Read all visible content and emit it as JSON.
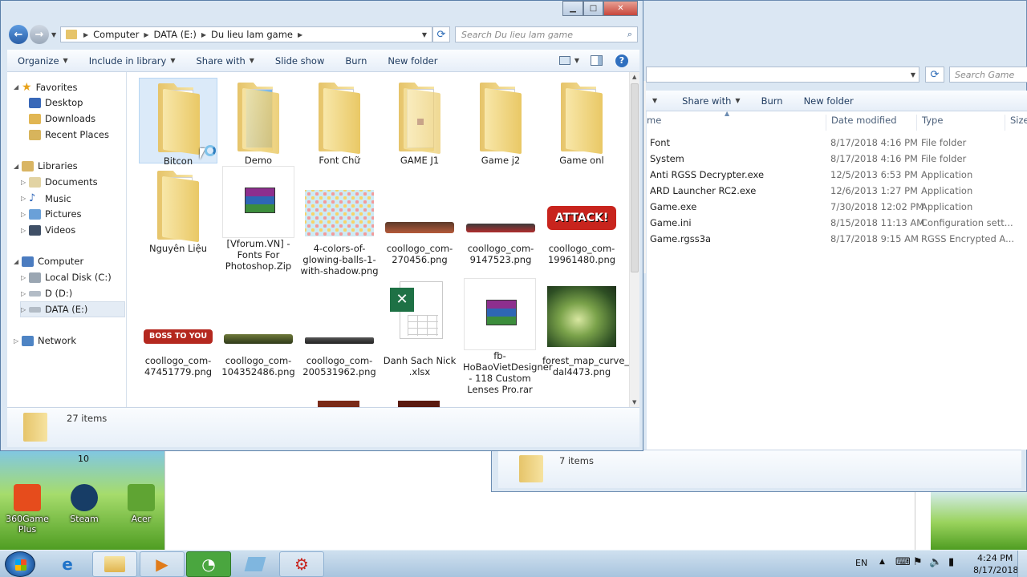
{
  "desktop": {
    "icons": [
      {
        "label": "360Game Plus",
        "color": "#e64c1c"
      },
      {
        "label": "Steam",
        "color": "#173d66"
      },
      {
        "label": "Acer",
        "color": "#5fa433"
      }
    ],
    "badge": "10"
  },
  "front": {
    "breadcrumb": [
      "Computer",
      "DATA (E:)",
      "Du lieu lam game"
    ],
    "search_placeholder": "Search Du lieu lam game",
    "toolbar": [
      "Organize",
      "Include in library",
      "Share with",
      "Slide show",
      "Burn",
      "New folder"
    ],
    "nav": {
      "favorites": "Favorites",
      "fav_items": [
        "Desktop",
        "Downloads",
        "Recent Places"
      ],
      "libraries": "Libraries",
      "lib_items": [
        "Documents",
        "Music",
        "Pictures",
        "Videos"
      ],
      "computer": "Computer",
      "comp_items": [
        "Local Disk (C:)",
        "D (D:)",
        "DATA (E:)"
      ],
      "network": "Network"
    },
    "files": [
      {
        "label": "Bitcon",
        "kind": "folder"
      },
      {
        "label": "Demo",
        "kind": "folder-blue"
      },
      {
        "label": "Font Chữ",
        "kind": "folder"
      },
      {
        "label": "GAME J1",
        "kind": "folder-game"
      },
      {
        "label": "Game j2",
        "kind": "folder"
      },
      {
        "label": "Game onl",
        "kind": "folder"
      },
      {
        "label": "Nguyên Liệu",
        "kind": "folder"
      },
      {
        "label": "[Vforum.VN] - Fonts For Photoshop.Zip",
        "kind": "rar"
      },
      {
        "label": "4-colors-of-glowing-balls-1-with-shadow.png",
        "kind": "balls"
      },
      {
        "label": "coollogo_com-270456.png",
        "kind": "logo"
      },
      {
        "label": "coollogo_com-9147523.png",
        "kind": "logo"
      },
      {
        "label": "coollogo_com-19961480.png",
        "kind": "logo-big",
        "text": "ATTACK!"
      },
      {
        "label": "coollogo_com-47451779.png",
        "kind": "logo-mid",
        "text": "BOSS TO YOU"
      },
      {
        "label": "coollogo_com-104352486.png",
        "kind": "logo"
      },
      {
        "label": "coollogo_com-200531962.png",
        "kind": "logo"
      },
      {
        "label": "Danh Sach Nick .xlsx",
        "kind": "xlsx"
      },
      {
        "label": "fb-HoBaoVietDesigner - 118 Custom Lenses Pro.rar",
        "kind": "rar"
      },
      {
        "label": "forest_map_curve_by_davidbrowne-dal4473.png",
        "kind": "forest"
      }
    ],
    "status": "27 items"
  },
  "back": {
    "search_placeholder": "Search Game",
    "toolbar": [
      "Share with",
      "Burn",
      "New folder"
    ],
    "columns": {
      "name": "me",
      "date": "Date modified",
      "type": "Type",
      "size": "Size"
    },
    "rows": [
      {
        "name": "Font",
        "date": "8/17/2018 4:16 PM",
        "type": "File folder"
      },
      {
        "name": "System",
        "date": "8/17/2018 4:16 PM",
        "type": "File folder"
      },
      {
        "name": "Anti RGSS Decrypter.exe",
        "date": "12/5/2013 6:53 PM",
        "type": "Application"
      },
      {
        "name": "ARD Launcher RC2.exe",
        "date": "12/6/2013 1:27 PM",
        "type": "Application"
      },
      {
        "name": "Game.exe",
        "date": "7/30/2018 12:02 PM",
        "type": "Application"
      },
      {
        "name": "Game.ini",
        "date": "8/15/2018 11:13 AM",
        "type": "Configuration sett..."
      },
      {
        "name": "Game.rgss3a",
        "date": "8/17/2018 9:15 AM",
        "type": "RGSS Encrypted A..."
      }
    ],
    "status": "7 items"
  },
  "taskbar": {
    "lang": "EN",
    "time": "4:24 PM",
    "date": "8/17/2018"
  },
  "colors": {
    "accent": "#3a6ea5",
    "selection": "#dbeaf9",
    "close": "#c7463b"
  }
}
